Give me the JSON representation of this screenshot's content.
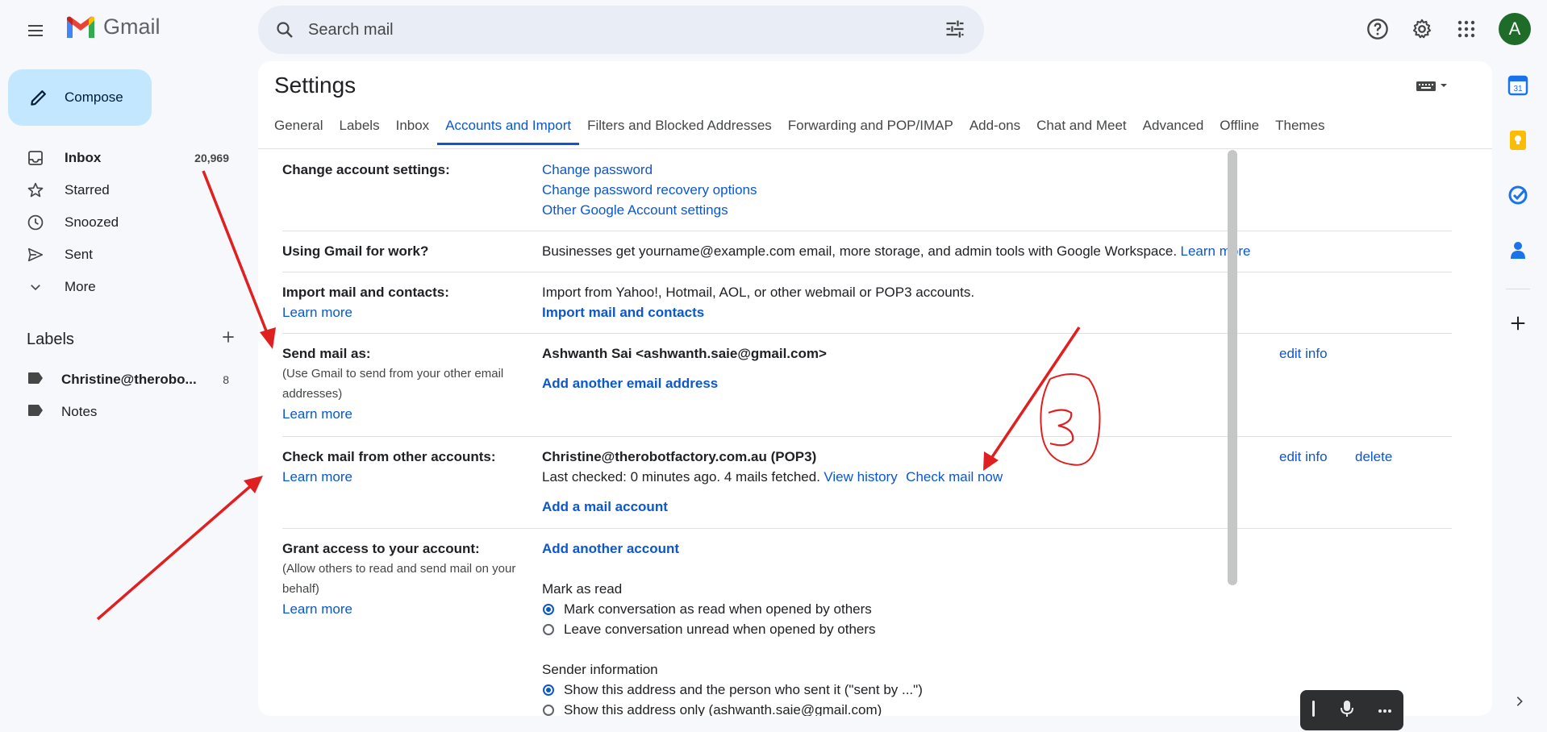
{
  "header": {
    "app_name": "Gmail",
    "search_placeholder": "Search mail",
    "avatar_letter": "A"
  },
  "sidebar": {
    "compose_label": "Compose",
    "items": [
      {
        "label": "Inbox",
        "count": "20,969",
        "icon": "inbox-icon"
      },
      {
        "label": "Starred",
        "count": "",
        "icon": "star-icon"
      },
      {
        "label": "Snoozed",
        "count": "",
        "icon": "clock-icon"
      },
      {
        "label": "Sent",
        "count": "",
        "icon": "send-icon"
      },
      {
        "label": "More",
        "count": "",
        "icon": "chevron-down-icon"
      }
    ],
    "labels_title": "Labels",
    "labels": [
      {
        "label": "Christine@therobo...",
        "count": "8"
      },
      {
        "label": "Notes",
        "count": ""
      }
    ]
  },
  "settings": {
    "title": "Settings",
    "tabs": [
      "General",
      "Labels",
      "Inbox",
      "Accounts and Import",
      "Filters and Blocked Addresses",
      "Forwarding and POP/IMAP",
      "Add-ons",
      "Chat and Meet",
      "Advanced",
      "Offline",
      "Themes"
    ],
    "active_tab": "Accounts and Import",
    "change_account": {
      "heading": "Change account settings:",
      "links": [
        "Change password",
        "Change password recovery options",
        "Other Google Account settings"
      ]
    },
    "work": {
      "heading": "Using Gmail for work?",
      "text": "Businesses get yourname@example.com email, more storage, and admin tools with Google Workspace.",
      "link": "Learn more"
    },
    "import": {
      "heading": "Import mail and contacts:",
      "learn_more": "Learn more",
      "text": "Import from Yahoo!, Hotmail, AOL, or other webmail or POP3 accounts.",
      "action": "Import mail and contacts"
    },
    "send_as": {
      "heading": "Send mail as:",
      "sub": "(Use Gmail to send from your other email addresses)",
      "learn_more": "Learn more",
      "address": "Ashwanth Sai <ashwanth.saie@gmail.com>",
      "edit": "edit info",
      "add": "Add another email address"
    },
    "check_mail": {
      "heading": "Check mail from other accounts:",
      "learn_more": "Learn more",
      "account": "Christine@therobotfactory.com.au (POP3)",
      "status": "Last checked: 0 minutes ago. 4 mails fetched.",
      "view_history": "View history",
      "check_now": "Check mail now",
      "edit": "edit info",
      "delete": "delete",
      "add": "Add a mail account"
    },
    "grant": {
      "heading": "Grant access to your account:",
      "sub": "(Allow others to read and send mail on your behalf)",
      "learn_more": "Learn more",
      "add": "Add another account",
      "mark_title": "Mark as read",
      "mark_opt1": "Mark conversation as read when opened by others",
      "mark_opt2": "Leave conversation unread when opened by others",
      "sender_title": "Sender information",
      "sender_opt1": "Show this address and the person who sent it (\"sent by ...\")",
      "sender_opt2": "Show this address only (ashwanth.saie@gmail.com)"
    }
  },
  "colors": {
    "link": "#0b57d0",
    "compose_bg": "#c2e7ff",
    "annotation": "#e02020"
  }
}
